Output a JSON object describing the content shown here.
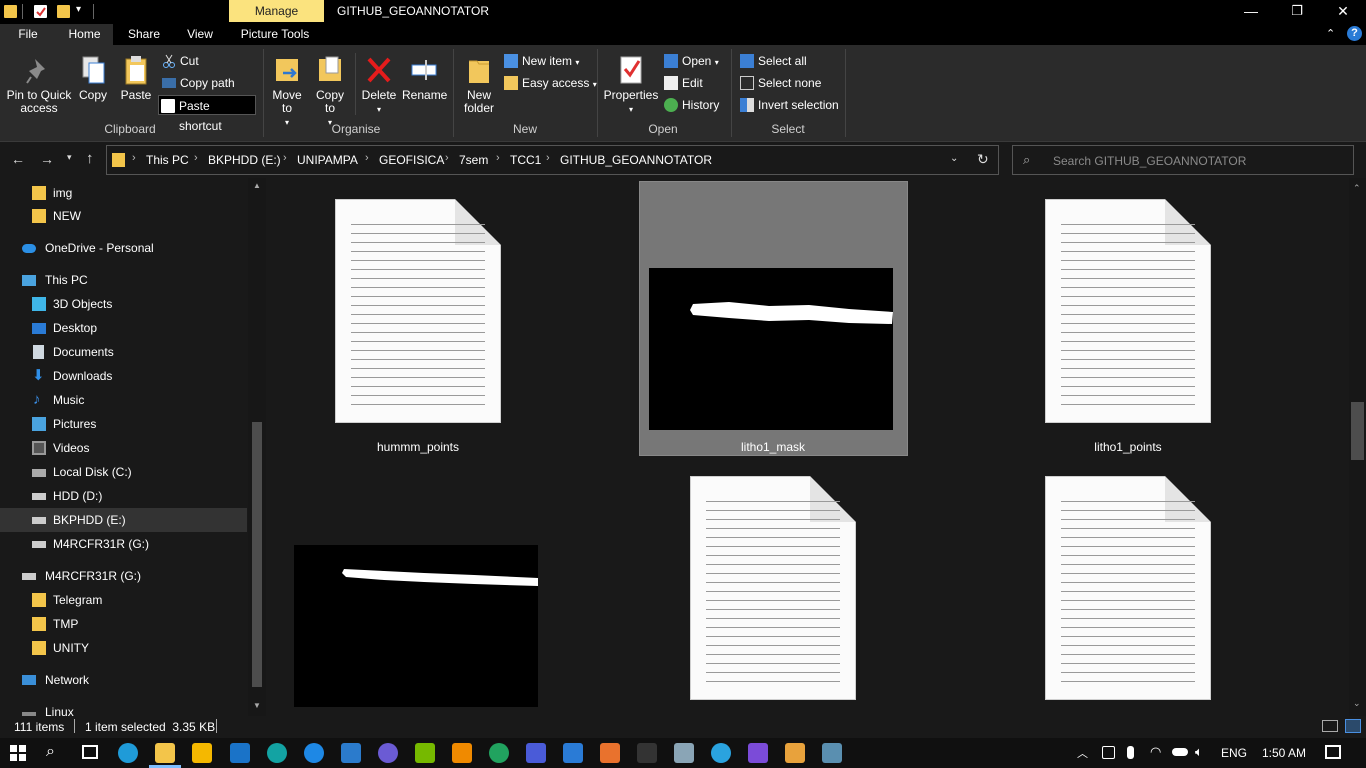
{
  "window": {
    "title": "GITHUB_GEOANNOTATOR",
    "context_tab": "Manage",
    "accent_color": "#fbe37e"
  },
  "tabs": [
    "File",
    "Home",
    "Share",
    "View",
    "Picture Tools"
  ],
  "ribbon": {
    "clipboard": {
      "pin_label": "Pin to Quick access",
      "copy_label": "Copy",
      "paste_label": "Paste",
      "cut_label": "Cut",
      "copy_path_label": "Copy path",
      "paste_shortcut_label": "Paste shortcut",
      "group_label": "Clipboard"
    },
    "organise": {
      "move_to_label": "Move to",
      "copy_to_label": "Copy to",
      "delete_label": "Delete",
      "rename_label": "Rename",
      "group_label": "Organise"
    },
    "new": {
      "new_folder_label": "New folder",
      "new_item_label": "New item",
      "easy_access_label": "Easy access",
      "group_label": "New"
    },
    "open": {
      "properties_label": "Properties",
      "open_label": "Open",
      "edit_label": "Edit",
      "history_label": "History",
      "group_label": "Open"
    },
    "select": {
      "select_all_label": "Select all",
      "select_none_label": "Select none",
      "invert_label": "Invert selection",
      "group_label": "Select"
    }
  },
  "address": {
    "crumbs": [
      "This PC",
      "BKPHDD (E:)",
      "UNIPAMPA",
      "GEOFISICA",
      "7sem",
      "TCC1",
      "GITHUB_GEOANNOTATOR"
    ],
    "search_placeholder": "Search GITHUB_GEOANNOTATOR"
  },
  "nav": {
    "img": "img",
    "new": "NEW",
    "onedrive": "OneDrive - Personal",
    "thispc": "This PC",
    "objects3d": "3D Objects",
    "desktop": "Desktop",
    "documents": "Documents",
    "downloads": "Downloads",
    "music": "Music",
    "pictures": "Pictures",
    "videos": "Videos",
    "localc": "Local Disk (C:)",
    "hddd": "HDD (D:)",
    "bkphdd": "BKPHDD (E:)",
    "m4rg": "M4RCFR31R (G:)",
    "m4rg2": "M4RCFR31R (G:)",
    "telegram": "Telegram",
    "tmp": "TMP",
    "unity": "UNITY",
    "network": "Network",
    "linux": "Linux"
  },
  "files": {
    "f1": "hummm_points",
    "f2": "litho1_mask",
    "f3": "litho1_points"
  },
  "status": {
    "count": "111 items",
    "selected": "1 item selected  3.35 KB"
  },
  "tray": {
    "lang": "ENG",
    "time": "1:50 AM"
  }
}
